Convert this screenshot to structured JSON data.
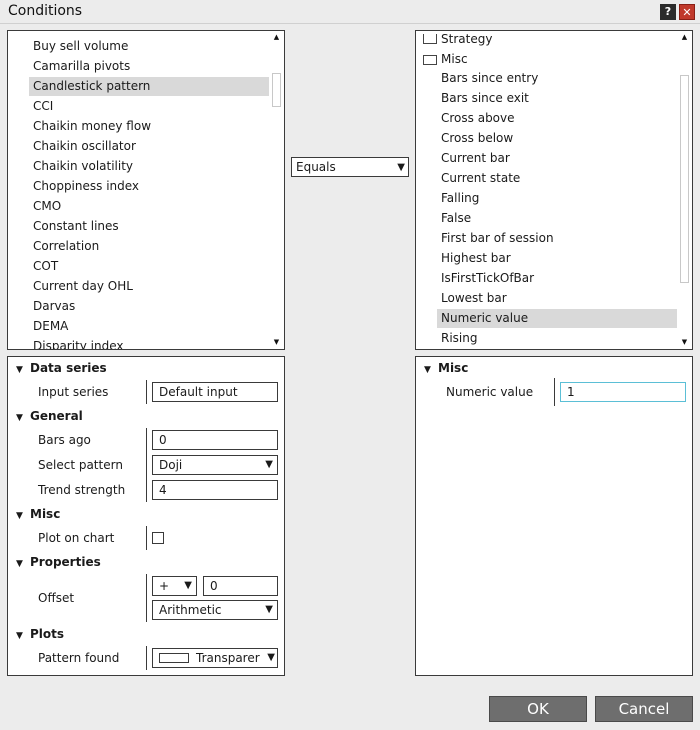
{
  "window": {
    "title": "Conditions",
    "help_label": "?",
    "close_label": "✕"
  },
  "left_list": {
    "items": [
      "Buy sell volume",
      "Camarilla pivots",
      "Candlestick pattern",
      "CCI",
      "Chaikin money flow",
      "Chaikin oscillator",
      "Chaikin volatility",
      "Choppiness index",
      "CMO",
      "Constant lines",
      "Correlation",
      "COT",
      "Current day OHL",
      "Darvas",
      "DEMA",
      "Disparity index"
    ],
    "selected": "Candlestick pattern"
  },
  "operator": {
    "value": "Equals"
  },
  "right_list": {
    "items": [
      "Strategy",
      "Misc",
      "Bars since entry",
      "Bars since exit",
      "Cross above",
      "Cross below",
      "Current bar",
      "Current state",
      "Falling",
      "False",
      "First bar of session",
      "Highest bar",
      "IsFirstTickOfBar",
      "Lowest bar",
      "Numeric value",
      "Rising"
    ],
    "selected": "Numeric value"
  },
  "left_props": {
    "data_series": {
      "title": "Data series",
      "input_series_label": "Input series",
      "input_series_value": "Default input"
    },
    "general": {
      "title": "General",
      "bars_ago_label": "Bars ago",
      "bars_ago_value": "0",
      "select_pattern_label": "Select pattern",
      "select_pattern_value": "Doji",
      "trend_strength_label": "Trend strength",
      "trend_strength_value": "4"
    },
    "misc": {
      "title": "Misc",
      "plot_on_chart_label": "Plot on chart"
    },
    "properties": {
      "title": "Properties",
      "offset_label": "Offset",
      "offset_sign": "+",
      "offset_value": "0",
      "offset_type": "Arithmetic"
    },
    "plots": {
      "title": "Plots",
      "pattern_found_label": "Pattern found",
      "pattern_found_value": "Transparer"
    }
  },
  "right_props": {
    "misc": {
      "title": "Misc",
      "numeric_value_label": "Numeric value",
      "numeric_value": "1"
    }
  },
  "buttons": {
    "ok": "OK",
    "cancel": "Cancel"
  }
}
